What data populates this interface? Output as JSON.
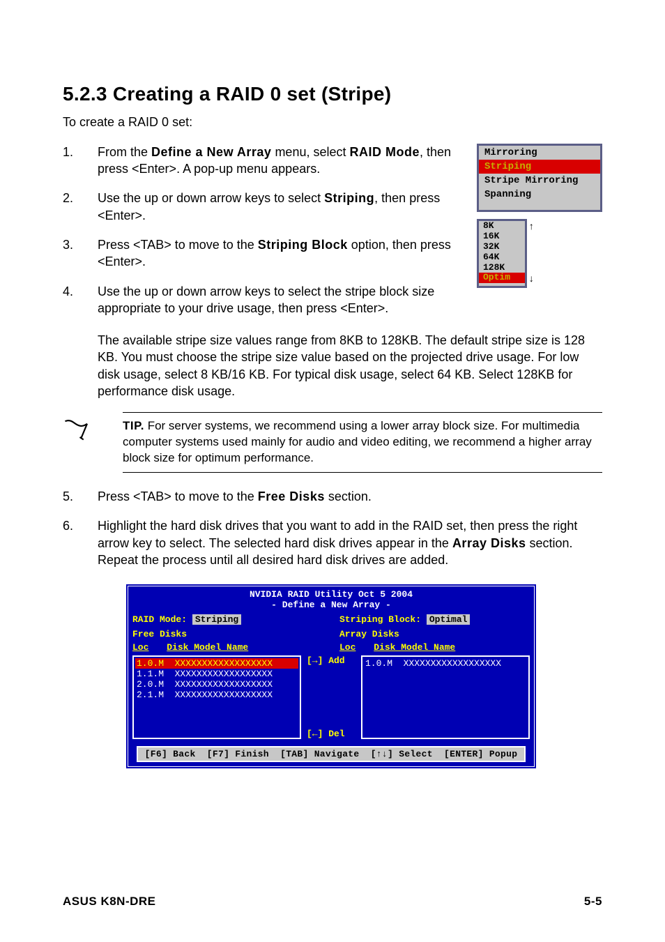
{
  "heading": "5.2.3   Creating a RAID 0 set (Stripe)",
  "intro": "To create a RAID 0 set:",
  "steps": [
    {
      "num": "1.",
      "pre": "From the ",
      "bold1": "Define a New Array",
      "mid1": " menu, select ",
      "bold2": "RAID Mode",
      "post": ", then press <Enter>. A pop-up menu appears."
    },
    {
      "num": "2.",
      "pre": "Use the up or down arrow keys to select ",
      "bold1": "Striping",
      "post": ", then press <Enter>."
    },
    {
      "num": "3.",
      "pre": "Press <TAB> to move to the ",
      "bold1": "Striping Block",
      "post": " option, then press <Enter>."
    },
    {
      "num": "4.",
      "text": "Use the up or down arrow keys to select the stripe block size appropriate to your drive usage, then press <Enter>."
    }
  ],
  "raid_popup": {
    "options": [
      "Mirroring",
      "Striping",
      "Stripe Mirroring",
      "Spanning"
    ],
    "selected_index": 1
  },
  "block_popup": {
    "options": [
      "8K",
      "16K",
      "32K",
      "64K",
      "128K",
      "Optim"
    ],
    "selected_index": 5,
    "arrow_up": "↑",
    "arrow_down": "↓"
  },
  "para_after4": "The available stripe size values range from 8KB to 128KB. The default stripe size is 128 KB. You must choose the stripe size value based on the projected drive usage. For low disk usage, select 8 KB/16 KB. For typical disk usage, select 64 KB. Select 128KB for performance disk usage.",
  "tip": {
    "label": "TIP.",
    "text": " For server systems, we recommend using a lower array block size. For multimedia computer systems used mainly for audio and video editing, we recommend a higher array block size for optimum performance."
  },
  "steps2": [
    {
      "num": "5.",
      "pre": "Press <TAB> to move to the ",
      "bold1": "Free Disks",
      "post": " section."
    },
    {
      "num": "6.",
      "pre": "Highlight the hard disk drives that you want to add in the RAID set, then press the right arrow key to select. The selected hard disk drives appear in the ",
      "bold1": "Array Disks",
      "post": " section. Repeat the process until all desired hard disk drives are added."
    }
  ],
  "bios": {
    "title": "NVIDIA RAID Utility  Oct 5 2004",
    "subtitle": "- Define a New Array -",
    "raid_mode_label": "RAID Mode:",
    "raid_mode_value": "Striping",
    "striping_block_label": "Striping Block:",
    "striping_block_value": "Optimal",
    "free_disks_label": "Free Disks",
    "array_disks_label": "Array Disks",
    "col_loc": "Loc",
    "col_model": "Disk Model Name",
    "free_rows": [
      {
        "loc": "1.0.M",
        "model": "XXXXXXXXXXXXXXXXXX",
        "selected": true
      },
      {
        "loc": "1.1.M",
        "model": "XXXXXXXXXXXXXXXXXX",
        "selected": false
      },
      {
        "loc": "2.0.M",
        "model": "XXXXXXXXXXXXXXXXXX",
        "selected": false
      },
      {
        "loc": "2.1.M",
        "model": "XXXXXXXXXXXXXXXXXX",
        "selected": false
      }
    ],
    "array_rows": [
      {
        "loc": "1.0.M",
        "model": "XXXXXXXXXXXXXXXXXX"
      }
    ],
    "add_label": "[→] Add",
    "del_label": "[←] Del",
    "footer": "[F6] Back  [F7] Finish  [TAB] Navigate  [↑↓] Select  [ENTER] Popup"
  },
  "footer": {
    "left": "ASUS K8N-DRE",
    "right": "5-5"
  }
}
